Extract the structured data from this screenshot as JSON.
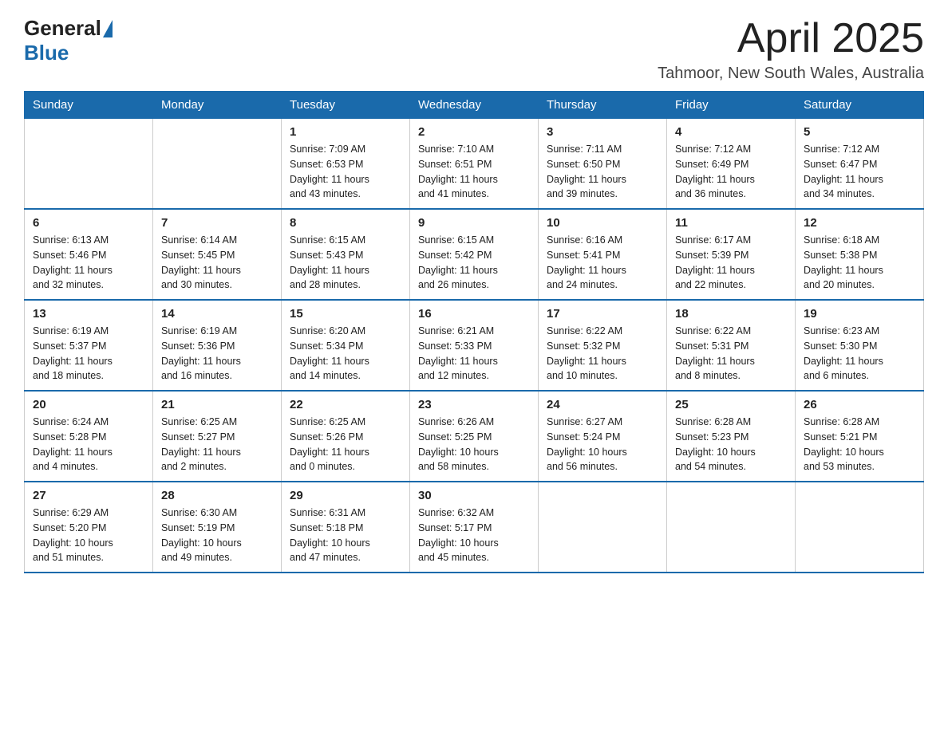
{
  "header": {
    "logo_general": "General",
    "logo_blue": "Blue",
    "title": "April 2025",
    "location": "Tahmoor, New South Wales, Australia"
  },
  "weekdays": [
    "Sunday",
    "Monday",
    "Tuesday",
    "Wednesday",
    "Thursday",
    "Friday",
    "Saturday"
  ],
  "weeks": [
    [
      {
        "day": "",
        "info": ""
      },
      {
        "day": "",
        "info": ""
      },
      {
        "day": "1",
        "info": "Sunrise: 7:09 AM\nSunset: 6:53 PM\nDaylight: 11 hours\nand 43 minutes."
      },
      {
        "day": "2",
        "info": "Sunrise: 7:10 AM\nSunset: 6:51 PM\nDaylight: 11 hours\nand 41 minutes."
      },
      {
        "day": "3",
        "info": "Sunrise: 7:11 AM\nSunset: 6:50 PM\nDaylight: 11 hours\nand 39 minutes."
      },
      {
        "day": "4",
        "info": "Sunrise: 7:12 AM\nSunset: 6:49 PM\nDaylight: 11 hours\nand 36 minutes."
      },
      {
        "day": "5",
        "info": "Sunrise: 7:12 AM\nSunset: 6:47 PM\nDaylight: 11 hours\nand 34 minutes."
      }
    ],
    [
      {
        "day": "6",
        "info": "Sunrise: 6:13 AM\nSunset: 5:46 PM\nDaylight: 11 hours\nand 32 minutes."
      },
      {
        "day": "7",
        "info": "Sunrise: 6:14 AM\nSunset: 5:45 PM\nDaylight: 11 hours\nand 30 minutes."
      },
      {
        "day": "8",
        "info": "Sunrise: 6:15 AM\nSunset: 5:43 PM\nDaylight: 11 hours\nand 28 minutes."
      },
      {
        "day": "9",
        "info": "Sunrise: 6:15 AM\nSunset: 5:42 PM\nDaylight: 11 hours\nand 26 minutes."
      },
      {
        "day": "10",
        "info": "Sunrise: 6:16 AM\nSunset: 5:41 PM\nDaylight: 11 hours\nand 24 minutes."
      },
      {
        "day": "11",
        "info": "Sunrise: 6:17 AM\nSunset: 5:39 PM\nDaylight: 11 hours\nand 22 minutes."
      },
      {
        "day": "12",
        "info": "Sunrise: 6:18 AM\nSunset: 5:38 PM\nDaylight: 11 hours\nand 20 minutes."
      }
    ],
    [
      {
        "day": "13",
        "info": "Sunrise: 6:19 AM\nSunset: 5:37 PM\nDaylight: 11 hours\nand 18 minutes."
      },
      {
        "day": "14",
        "info": "Sunrise: 6:19 AM\nSunset: 5:36 PM\nDaylight: 11 hours\nand 16 minutes."
      },
      {
        "day": "15",
        "info": "Sunrise: 6:20 AM\nSunset: 5:34 PM\nDaylight: 11 hours\nand 14 minutes."
      },
      {
        "day": "16",
        "info": "Sunrise: 6:21 AM\nSunset: 5:33 PM\nDaylight: 11 hours\nand 12 minutes."
      },
      {
        "day": "17",
        "info": "Sunrise: 6:22 AM\nSunset: 5:32 PM\nDaylight: 11 hours\nand 10 minutes."
      },
      {
        "day": "18",
        "info": "Sunrise: 6:22 AM\nSunset: 5:31 PM\nDaylight: 11 hours\nand 8 minutes."
      },
      {
        "day": "19",
        "info": "Sunrise: 6:23 AM\nSunset: 5:30 PM\nDaylight: 11 hours\nand 6 minutes."
      }
    ],
    [
      {
        "day": "20",
        "info": "Sunrise: 6:24 AM\nSunset: 5:28 PM\nDaylight: 11 hours\nand 4 minutes."
      },
      {
        "day": "21",
        "info": "Sunrise: 6:25 AM\nSunset: 5:27 PM\nDaylight: 11 hours\nand 2 minutes."
      },
      {
        "day": "22",
        "info": "Sunrise: 6:25 AM\nSunset: 5:26 PM\nDaylight: 11 hours\nand 0 minutes."
      },
      {
        "day": "23",
        "info": "Sunrise: 6:26 AM\nSunset: 5:25 PM\nDaylight: 10 hours\nand 58 minutes."
      },
      {
        "day": "24",
        "info": "Sunrise: 6:27 AM\nSunset: 5:24 PM\nDaylight: 10 hours\nand 56 minutes."
      },
      {
        "day": "25",
        "info": "Sunrise: 6:28 AM\nSunset: 5:23 PM\nDaylight: 10 hours\nand 54 minutes."
      },
      {
        "day": "26",
        "info": "Sunrise: 6:28 AM\nSunset: 5:21 PM\nDaylight: 10 hours\nand 53 minutes."
      }
    ],
    [
      {
        "day": "27",
        "info": "Sunrise: 6:29 AM\nSunset: 5:20 PM\nDaylight: 10 hours\nand 51 minutes."
      },
      {
        "day": "28",
        "info": "Sunrise: 6:30 AM\nSunset: 5:19 PM\nDaylight: 10 hours\nand 49 minutes."
      },
      {
        "day": "29",
        "info": "Sunrise: 6:31 AM\nSunset: 5:18 PM\nDaylight: 10 hours\nand 47 minutes."
      },
      {
        "day": "30",
        "info": "Sunrise: 6:32 AM\nSunset: 5:17 PM\nDaylight: 10 hours\nand 45 minutes."
      },
      {
        "day": "",
        "info": ""
      },
      {
        "day": "",
        "info": ""
      },
      {
        "day": "",
        "info": ""
      }
    ]
  ]
}
